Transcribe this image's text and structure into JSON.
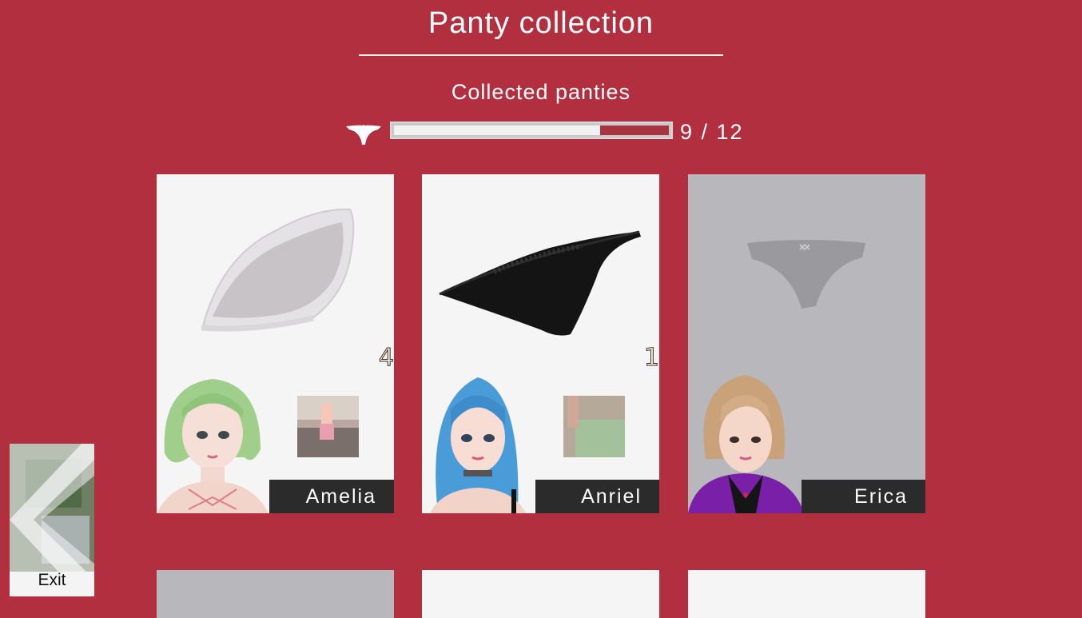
{
  "header": {
    "title": "Panty collection",
    "subtitle": "Collected panties"
  },
  "progress": {
    "collected": 9,
    "total": 12,
    "label": "9 / 12",
    "fraction": 0.75,
    "icon": "panty-icon"
  },
  "cards": [
    {
      "name": "Amelia",
      "count": "4",
      "collected": true
    },
    {
      "name": "Anriel",
      "count": "1",
      "collected": true
    },
    {
      "name": "Erica",
      "count": "",
      "collected": false
    }
  ],
  "exit": {
    "label": "Exit",
    "icon": "back-arrow-icon"
  },
  "colors": {
    "background": "#b12f3f",
    "card": "#f5f5f5",
    "card_locked": "#b8b7bb",
    "name_bar": "#2b2b2b"
  }
}
